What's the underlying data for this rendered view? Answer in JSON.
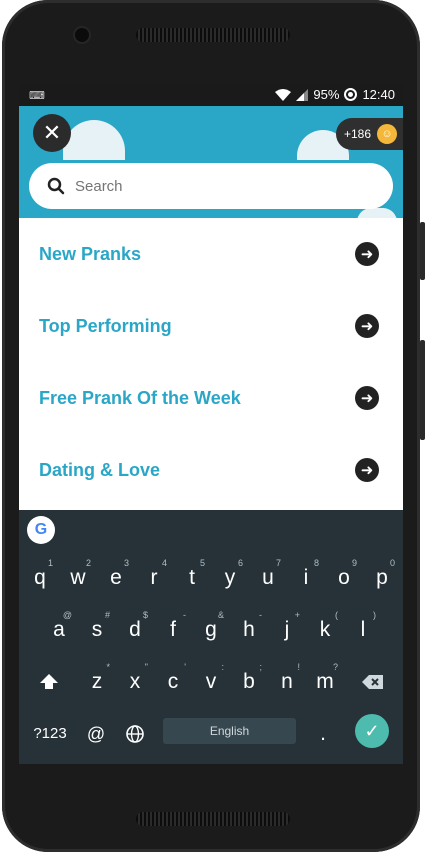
{
  "status_bar": {
    "battery": "95%",
    "time": "12:40",
    "keyboard_icon": "keyboard-icon"
  },
  "header": {
    "close_icon": "close-icon",
    "coins": "+186"
  },
  "search": {
    "placeholder": "Search",
    "value": ""
  },
  "menu": [
    {
      "label": "New Pranks"
    },
    {
      "label": "Top Performing"
    },
    {
      "label": "Free Prank Of the Week"
    },
    {
      "label": "Dating & Love"
    }
  ],
  "keyboard": {
    "row1": [
      {
        "k": "q",
        "h": "1"
      },
      {
        "k": "w",
        "h": "2"
      },
      {
        "k": "e",
        "h": "3"
      },
      {
        "k": "r",
        "h": "4"
      },
      {
        "k": "t",
        "h": "5"
      },
      {
        "k": "y",
        "h": "6"
      },
      {
        "k": "u",
        "h": "7"
      },
      {
        "k": "i",
        "h": "8"
      },
      {
        "k": "o",
        "h": "9"
      },
      {
        "k": "p",
        "h": "0"
      }
    ],
    "row2": [
      {
        "k": "a",
        "h": "@"
      },
      {
        "k": "s",
        "h": "#"
      },
      {
        "k": "d",
        "h": "$"
      },
      {
        "k": "f",
        "h": "-"
      },
      {
        "k": "g",
        "h": "&"
      },
      {
        "k": "h",
        "h": "-"
      },
      {
        "k": "j",
        "h": "+"
      },
      {
        "k": "k",
        "h": "("
      },
      {
        "k": "l",
        "h": ")"
      }
    ],
    "row3": [
      {
        "k": "z",
        "h": "*"
      },
      {
        "k": "x",
        "h": "\""
      },
      {
        "k": "c",
        "h": "'"
      },
      {
        "k": "v",
        "h": ":"
      },
      {
        "k": "b",
        "h": ";"
      },
      {
        "k": "n",
        "h": "!"
      },
      {
        "k": "m",
        "h": "?"
      }
    ],
    "symbols": "?123",
    "at": "@",
    "space": "English",
    "period": "."
  },
  "colors": {
    "accent": "#2aa6c6",
    "keyboard_bg": "#263238",
    "enter": "#4dbbad"
  }
}
